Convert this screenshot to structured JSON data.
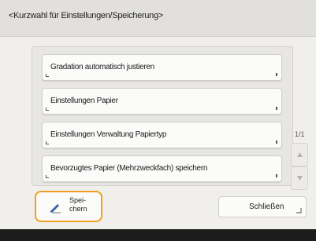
{
  "window": {
    "title": "<Kurzwahl für Einstellungen/Speicherung>"
  },
  "menu": {
    "items": [
      {
        "label": "Gradation automatisch justieren"
      },
      {
        "label": "Einstellungen Papier"
      },
      {
        "label": "Einstellungen Verwaltung Papiertyp"
      },
      {
        "label": "Bevorzugtes Papier (Mehrzweckfach) speichern"
      }
    ]
  },
  "pagination": {
    "page_indicator": "1/1",
    "up_icon": "triangle-up-icon",
    "down_icon": "triangle-down-icon"
  },
  "footer": {
    "save_label": "Spei-\nchern",
    "save_icon": "pen-icon",
    "close_label": "Schließen"
  },
  "colors": {
    "highlight": "#f0a020",
    "title_bar": "#e1e0dc",
    "background": "#f0efeb",
    "bottom_bar": "#1c1c1c"
  }
}
